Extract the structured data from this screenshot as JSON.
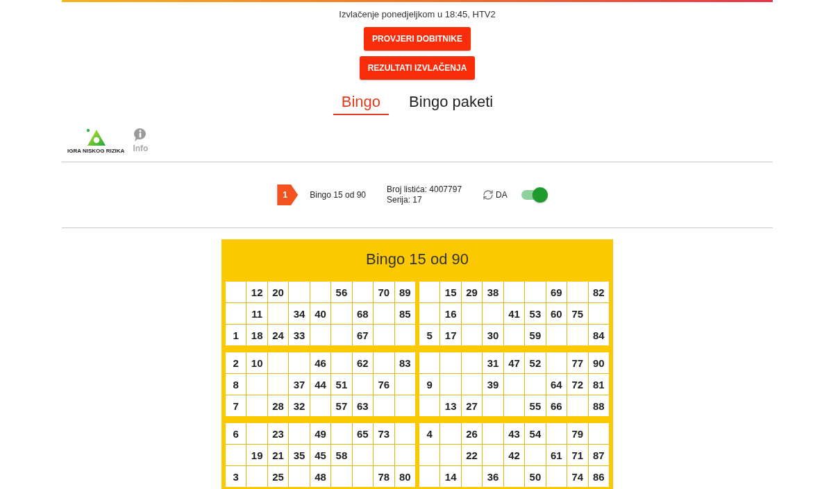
{
  "draw_info": "Izvlačenje ponedjeljkom u 18:45, HTV2",
  "buttons": [
    "PROVJERI DOBITNIKE",
    "REZULTATI IZVLAČENJA"
  ],
  "tabs": [
    {
      "label": "Bingo",
      "selected": true
    },
    {
      "label": "Bingo paketi",
      "selected": false
    }
  ],
  "logo": {
    "caption": "IGRA NISKOG RIZIKA"
  },
  "info_link": {
    "label": "Info"
  },
  "ticket": {
    "number": "1",
    "game": "Bingo 15 od 90",
    "ticket_number": "Broj listića: 4007797",
    "series": "Serija: 17",
    "repeat": {
      "label": "DA",
      "on": true
    }
  },
  "bingo_card": {
    "title": "Bingo 15 od 90",
    "tickets": [
      {
        "rows": [
          [
            null,
            "12",
            "20",
            null,
            null,
            "56",
            null,
            "70",
            "89"
          ],
          [
            null,
            "11",
            null,
            "34",
            "40",
            null,
            "68",
            null,
            "85"
          ],
          [
            "1",
            "18",
            "24",
            "33",
            null,
            null,
            "67",
            null,
            null
          ]
        ]
      },
      {
        "rows": [
          [
            null,
            "15",
            "29",
            "38",
            null,
            null,
            "69",
            null,
            "82"
          ],
          [
            null,
            "16",
            null,
            null,
            "41",
            "53",
            "60",
            "75",
            null
          ],
          [
            "5",
            "17",
            null,
            "30",
            null,
            "59",
            null,
            null,
            "84"
          ]
        ]
      },
      {
        "rows": [
          [
            "2",
            "10",
            null,
            null,
            "46",
            null,
            "62",
            null,
            "83"
          ],
          [
            "8",
            null,
            null,
            "37",
            "44",
            "51",
            null,
            "76",
            null
          ],
          [
            "7",
            null,
            "28",
            "32",
            null,
            "57",
            "63",
            null,
            null
          ]
        ]
      },
      {
        "rows": [
          [
            null,
            null,
            null,
            "31",
            "47",
            "52",
            null,
            "77",
            "90"
          ],
          [
            "9",
            null,
            null,
            "39",
            null,
            null,
            "64",
            "72",
            "81"
          ],
          [
            null,
            "13",
            "27",
            null,
            null,
            "55",
            "66",
            null,
            "88"
          ]
        ]
      },
      {
        "rows": [
          [
            "6",
            null,
            "23",
            null,
            "49",
            null,
            "65",
            "73",
            null
          ],
          [
            null,
            "19",
            "21",
            "35",
            "45",
            "58",
            null,
            null,
            null
          ],
          [
            "3",
            null,
            "25",
            null,
            "48",
            null,
            null,
            "78",
            "80"
          ]
        ]
      },
      {
        "rows": [
          [
            "4",
            null,
            "26",
            null,
            "43",
            "54",
            null,
            "79",
            null
          ],
          [
            null,
            null,
            "22",
            null,
            "42",
            null,
            "61",
            "71",
            "87"
          ],
          [
            null,
            "14",
            null,
            "36",
            null,
            "50",
            null,
            "74",
            "86"
          ]
        ]
      }
    ]
  }
}
